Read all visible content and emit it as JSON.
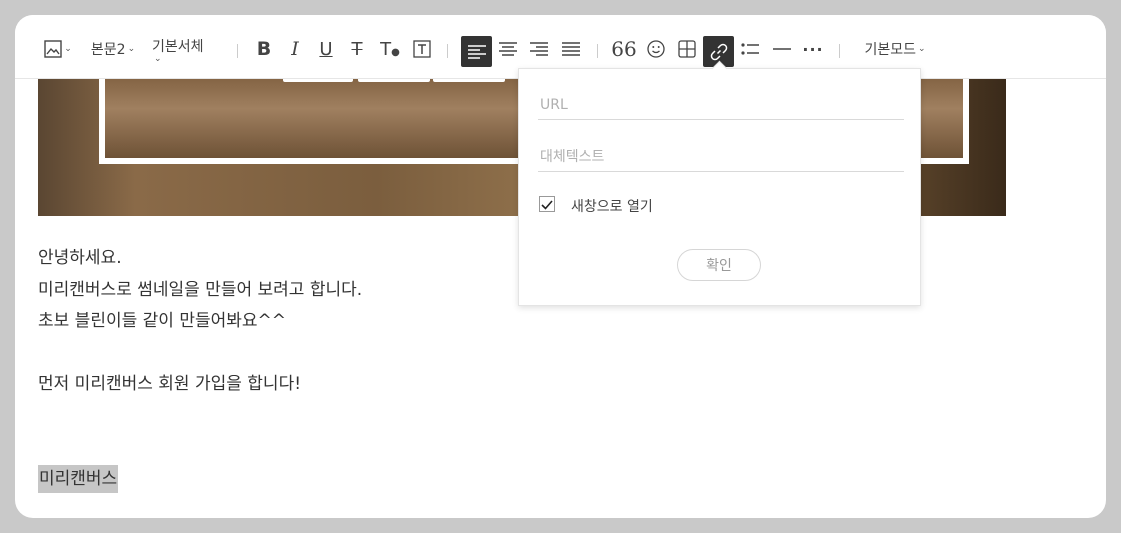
{
  "toolbar": {
    "paragraph_style": "본문2",
    "font": "기본서체",
    "mode": "기본모드",
    "icons": [
      "image-icon",
      "bold-icon",
      "italic-icon",
      "underline-icon",
      "strikethrough-icon",
      "text-color-icon",
      "text-background-icon",
      "align-left-icon",
      "align-center-icon",
      "align-right-icon",
      "align-justify-icon",
      "quote-icon",
      "emoji-icon",
      "table-icon",
      "link-icon",
      "list-icon",
      "divider-icon",
      "more-icon"
    ],
    "active_color": "#333333"
  },
  "content": {
    "lines": [
      "안녕하세요.",
      "미리캔버스로 썸네일을 만들어 보려고 합니다.",
      "초보 블린이들 같이 만들어봐요^^",
      "",
      "먼저 미리캔버스 회원 가입을 합니다!",
      "",
      ""
    ],
    "selected_text": "미리캔버스"
  },
  "link_popover": {
    "url_placeholder": "URL",
    "alt_placeholder": "대체텍스트",
    "new_window_label": "새창으로 열기",
    "new_window_checked": true,
    "confirm_label": "확인"
  }
}
